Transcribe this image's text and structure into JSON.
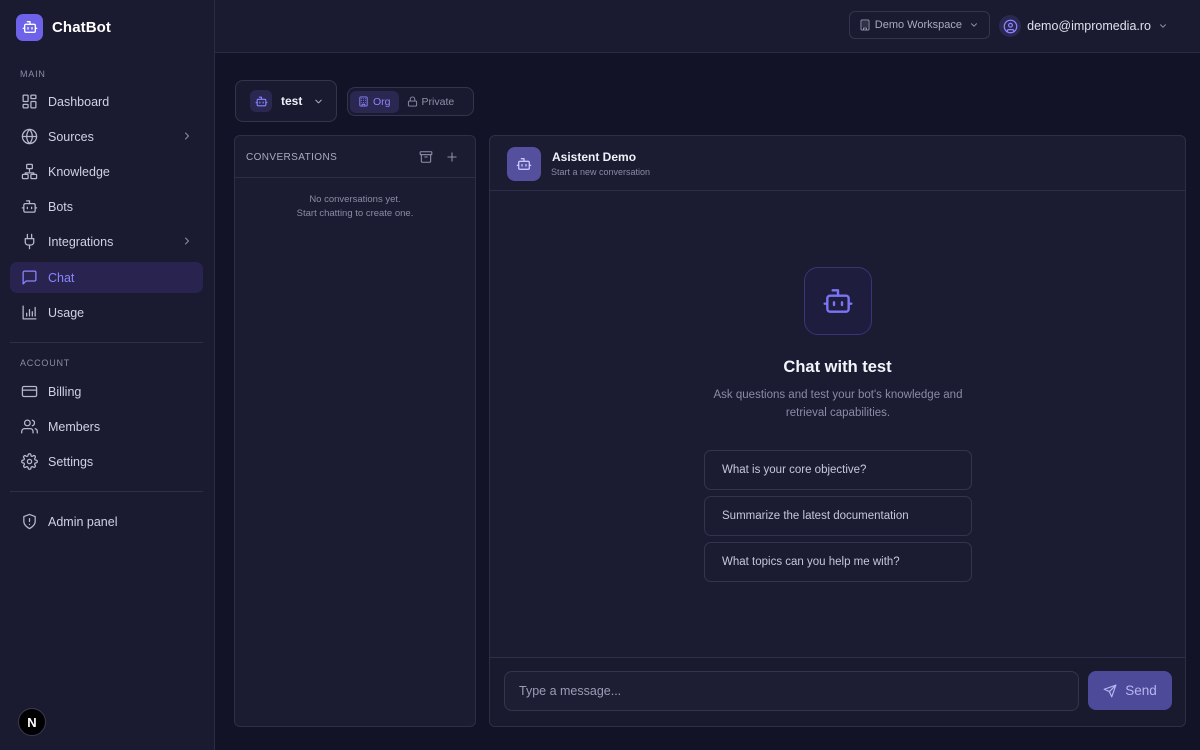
{
  "brand": {
    "name": "ChatBot"
  },
  "sidebar": {
    "main_label": "MAIN",
    "main_items": [
      {
        "label": "Dashboard",
        "icon": "dashboard-icon"
      },
      {
        "label": "Sources",
        "icon": "globe-icon",
        "has_submenu": true
      },
      {
        "label": "Knowledge",
        "icon": "knowledge-icon"
      },
      {
        "label": "Bots",
        "icon": "bot-icon"
      },
      {
        "label": "Integrations",
        "icon": "plug-icon",
        "has_submenu": true
      },
      {
        "label": "Chat",
        "icon": "chat-icon",
        "active": true
      },
      {
        "label": "Usage",
        "icon": "bar-chart-icon"
      }
    ],
    "account_label": "ACCOUNT",
    "account_items": [
      {
        "label": "Billing",
        "icon": "credit-card-icon"
      },
      {
        "label": "Members",
        "icon": "users-icon"
      },
      {
        "label": "Settings",
        "icon": "gear-icon"
      }
    ],
    "admin_item": {
      "label": "Admin panel",
      "icon": "shield-icon"
    },
    "badge": "N"
  },
  "topbar": {
    "workspace": "Demo Workspace",
    "user_email": "demo@impromedia.ro"
  },
  "bot_bar": {
    "bot_name": "test",
    "visibility_options": [
      "Org",
      "Private"
    ],
    "visibility_selected": "Org"
  },
  "conversations": {
    "title": "CONVERSATIONS",
    "empty_line1": "No conversations yet.",
    "empty_line2": "Start chatting to create one."
  },
  "chat": {
    "header_name": "Asistent Demo",
    "header_sub": "Start a new conversation",
    "hero_title": "Chat with test",
    "hero_desc": "Ask questions and test your bot's knowledge and retrieval capabilities.",
    "suggestions": [
      "What is your core objective?",
      "Summarize the latest documentation",
      "What topics can you help me with?"
    ],
    "input_placeholder": "Type a message...",
    "send_label": "Send"
  },
  "colors": {
    "background": "#131327",
    "sidebar": "#1a1a30",
    "accent": "#8b84ff",
    "brand": "#6e63e8",
    "send_button": "#4d4a9a"
  }
}
